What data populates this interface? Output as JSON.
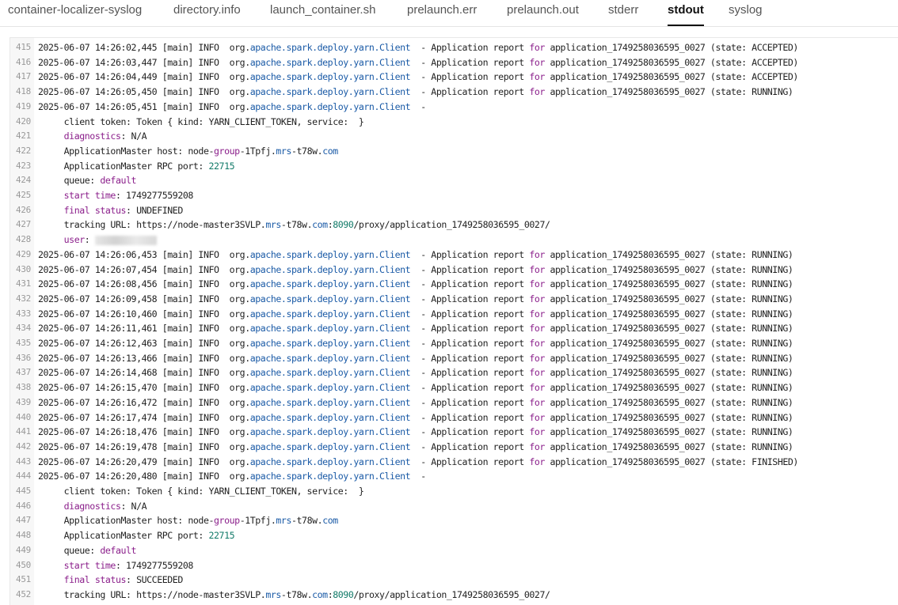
{
  "tabs": [
    {
      "label": "container-localizer-syslog",
      "active": false
    },
    {
      "label": "directory.info",
      "active": false
    },
    {
      "label": "launch_container.sh",
      "active": false
    },
    {
      "label": "prelaunch.err",
      "active": false
    },
    {
      "label": "prelaunch.out",
      "active": false
    },
    {
      "label": "stderr",
      "active": false
    },
    {
      "label": "stdout",
      "active": true
    },
    {
      "label": "syslog",
      "active": false
    }
  ],
  "log": {
    "first_line": 415,
    "lines": [
      "2025-06-07 14:26:02,445 [main] INFO  org.apache.spark.deploy.yarn.Client  - Application report for application_1749258036595_0027 (state: ACCEPTED)",
      "2025-06-07 14:26:03,447 [main] INFO  org.apache.spark.deploy.yarn.Client  - Application report for application_1749258036595_0027 (state: ACCEPTED)",
      "2025-06-07 14:26:04,449 [main] INFO  org.apache.spark.deploy.yarn.Client  - Application report for application_1749258036595_0027 (state: ACCEPTED)",
      "2025-06-07 14:26:05,450 [main] INFO  org.apache.spark.deploy.yarn.Client  - Application report for application_1749258036595_0027 (state: RUNNING)",
      "2025-06-07 14:26:05,451 [main] INFO  org.apache.spark.deploy.yarn.Client  -",
      "     client token: Token { kind: YARN_CLIENT_TOKEN, service:  }",
      "     diagnostics: N/A",
      "     ApplicationMaster host: node-group-1Tpfj.mrs-t78w.com",
      "     ApplicationMaster RPC port: 22715",
      "     queue: default",
      "     start time: 1749277559208",
      "     final status: UNDEFINED",
      "     tracking URL: https://node-master3SVLP.mrs-t78w.com:8090/proxy/application_1749258036595_0027/",
      "     user: ",
      "2025-06-07 14:26:06,453 [main] INFO  org.apache.spark.deploy.yarn.Client  - Application report for application_1749258036595_0027 (state: RUNNING)",
      "2025-06-07 14:26:07,454 [main] INFO  org.apache.spark.deploy.yarn.Client  - Application report for application_1749258036595_0027 (state: RUNNING)",
      "2025-06-07 14:26:08,456 [main] INFO  org.apache.spark.deploy.yarn.Client  - Application report for application_1749258036595_0027 (state: RUNNING)",
      "2025-06-07 14:26:09,458 [main] INFO  org.apache.spark.deploy.yarn.Client  - Application report for application_1749258036595_0027 (state: RUNNING)",
      "2025-06-07 14:26:10,460 [main] INFO  org.apache.spark.deploy.yarn.Client  - Application report for application_1749258036595_0027 (state: RUNNING)",
      "2025-06-07 14:26:11,461 [main] INFO  org.apache.spark.deploy.yarn.Client  - Application report for application_1749258036595_0027 (state: RUNNING)",
      "2025-06-07 14:26:12,463 [main] INFO  org.apache.spark.deploy.yarn.Client  - Application report for application_1749258036595_0027 (state: RUNNING)",
      "2025-06-07 14:26:13,466 [main] INFO  org.apache.spark.deploy.yarn.Client  - Application report for application_1749258036595_0027 (state: RUNNING)",
      "2025-06-07 14:26:14,468 [main] INFO  org.apache.spark.deploy.yarn.Client  - Application report for application_1749258036595_0027 (state: RUNNING)",
      "2025-06-07 14:26:15,470 [main] INFO  org.apache.spark.deploy.yarn.Client  - Application report for application_1749258036595_0027 (state: RUNNING)",
      "2025-06-07 14:26:16,472 [main] INFO  org.apache.spark.deploy.yarn.Client  - Application report for application_1749258036595_0027 (state: RUNNING)",
      "2025-06-07 14:26:17,474 [main] INFO  org.apache.spark.deploy.yarn.Client  - Application report for application_1749258036595_0027 (state: RUNNING)",
      "2025-06-07 14:26:18,476 [main] INFO  org.apache.spark.deploy.yarn.Client  - Application report for application_1749258036595_0027 (state: RUNNING)",
      "2025-06-07 14:26:19,478 [main] INFO  org.apache.spark.deploy.yarn.Client  - Application report for application_1749258036595_0027 (state: RUNNING)",
      "2025-06-07 14:26:20,479 [main] INFO  org.apache.spark.deploy.yarn.Client  - Application report for application_1749258036595_0027 (state: FINISHED)",
      "2025-06-07 14:26:20,480 [main] INFO  org.apache.spark.deploy.yarn.Client  -",
      "     client token: Token { kind: YARN_CLIENT_TOKEN, service:  }",
      "     diagnostics: N/A",
      "     ApplicationMaster host: node-group-1Tpfj.mrs-t78w.com",
      "     ApplicationMaster RPC port: 22715",
      "     queue: default",
      "     start time: 1749277559208",
      "     final status: SUCCEEDED",
      "     tracking URL: https://node-master3SVLP.mrs-t78w.com:8090/proxy/application_1749258036595_0027/"
    ]
  },
  "colors": {
    "keyword": "#8b1f8b",
    "namespace": "#1a5aa6",
    "number": "#117a68"
  }
}
